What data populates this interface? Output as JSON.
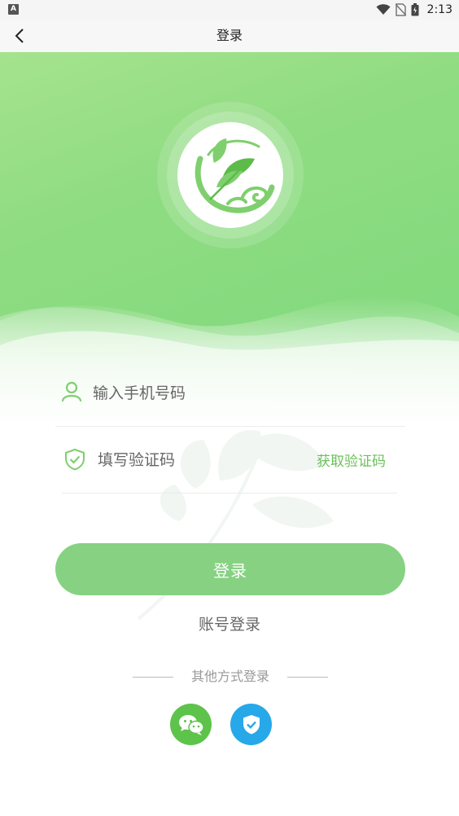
{
  "status_bar": {
    "notification_icon": "A",
    "time": "2:13",
    "icons": [
      "wifi-icon",
      "no-sim-icon",
      "battery-icon"
    ]
  },
  "header": {
    "title": "登录",
    "back_icon": "chevron-left-icon"
  },
  "logo": {
    "icon": "herb-leaf-logo-icon",
    "colors": {
      "primary": "#7fcf6e",
      "accent": "#5dbb4a"
    }
  },
  "form": {
    "phone": {
      "placeholder": "输入手机号码",
      "value": "",
      "icon": "user-icon"
    },
    "code": {
      "placeholder": "填写验证码",
      "value": "",
      "icon": "shield-check-icon"
    },
    "get_code_label": "获取验证码"
  },
  "login_button_label": "登录",
  "account_login_label": "账号登录",
  "other_login": {
    "label": "其他方式登录",
    "methods": [
      {
        "icon": "wechat-icon",
        "color": "#5ec34b"
      },
      {
        "icon": "shield-verify-icon",
        "color": "#27a8e8"
      }
    ]
  },
  "theme": {
    "brand_green": "#86d282",
    "link_green": "#6cc05c",
    "hero_gradient": [
      "#a5e38e",
      "#7dd87b"
    ]
  }
}
